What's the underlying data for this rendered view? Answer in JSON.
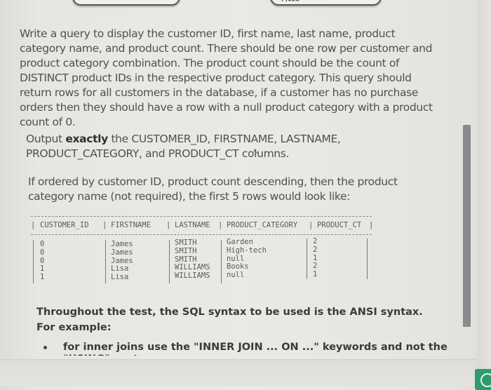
{
  "top_controls": {
    "left_pill_text": "",
    "right_pill_text": "Date"
  },
  "question": {
    "paragraph1": "Write a query to display the customer ID, first name, last name, product category name, and product count. There should be one row per customer and product category combination. The product count should be the count of DISTINCT product IDs in the respective product category. This query should return rows for all customers in the database, if a customer has no purchase orders then they should have a row with a null product category with a product count of 0.",
    "paragraph2_prefix": "Output ",
    "paragraph2_bold": "exactly",
    "paragraph2_suffix_part1": " the CUSTOMER_ID, FIRSTN",
    "paragraph2_suffix_part2": "AME, LASTNAME, PRODUCT_CATEGORY, and PRODUCT_CT columns.",
    "paragraph3": "If ordered by customer ID, product count descending, then the product category name (not required), the first 5 rows would look like:"
  },
  "result_table": {
    "columns": [
      "CUSTOMER_ID",
      "FIRSTNAME",
      "LASTNAME",
      "PRODUCT_CATEGORY",
      "PRODUCT_CT"
    ],
    "rows": [
      {
        "customer_id": "0",
        "firstname": "James",
        "lastname": "SMITH",
        "product_category": "Garden",
        "product_ct": "2"
      },
      {
        "customer_id": "0",
        "firstname": "James",
        "lastname": "SMITH",
        "product_category": "High-tech",
        "product_ct": "2"
      },
      {
        "customer_id": "0",
        "firstname": "James",
        "lastname": "SMITH",
        "product_category": "null",
        "product_ct": "1"
      },
      {
        "customer_id": "1",
        "firstname": "Lisa",
        "lastname": "WILLIAMS",
        "product_category": "Books",
        "product_ct": "2"
      },
      {
        "customer_id": "1",
        "firstname": "Lisa",
        "lastname": "WILLIAMS",
        "product_category": "null",
        "product_ct": "1"
      }
    ]
  },
  "ansi_note": {
    "text": "Throughout the test, the SQL syntax to be used is the ANSI syntax. For example:",
    "bullets": [
      {
        "line1": "for inner joins use the \"INNER JOIN ... ON ...\" keywords and not the",
        "line2_partial": "\"USING\" syntax"
      }
    ]
  },
  "colors": {
    "background": "#e8e8e4",
    "text": "#505050",
    "scrollbar_thumb": "#8a8a8c",
    "green_button": "#2f9a6e"
  }
}
